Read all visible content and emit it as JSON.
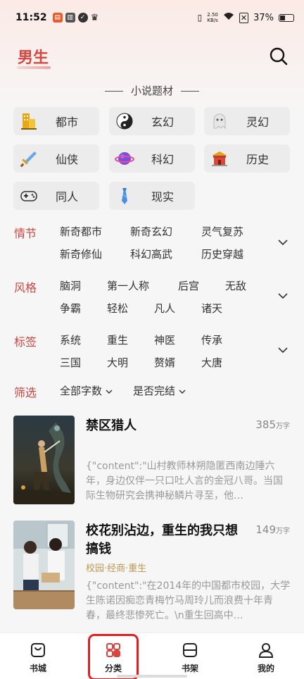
{
  "status_bar": {
    "time": "11:52",
    "net_speed_top": "2.50",
    "net_speed_bottom": "KB/s",
    "battery": "37%"
  },
  "header": {
    "title": "男生"
  },
  "section": {
    "label": "小说题材"
  },
  "genres": [
    {
      "label": "都市",
      "icon": "city-building-icon"
    },
    {
      "label": "玄幻",
      "icon": "yin-yang-icon"
    },
    {
      "label": "灵幻",
      "icon": "ghost-icon"
    },
    {
      "label": "仙侠",
      "icon": "sword-icon"
    },
    {
      "label": "科幻",
      "icon": "planet-icon"
    },
    {
      "label": "历史",
      "icon": "palace-icon"
    },
    {
      "label": "同人",
      "icon": "gamepad-icon"
    },
    {
      "label": "现实",
      "icon": "necktie-icon"
    }
  ],
  "filters": {
    "plot": {
      "label": "情节",
      "options": [
        "新奇都市",
        "新奇玄幻",
        "灵气复苏",
        "新奇修仙",
        "科幻高武",
        "历史穿越"
      ]
    },
    "style": {
      "label": "风格",
      "options": [
        "脑洞",
        "第一人称",
        "后宫",
        "无敌",
        "争霸",
        "轻松",
        "凡人",
        "诸天"
      ]
    },
    "tags": {
      "label": "标签",
      "options": [
        "系统",
        "重生",
        "神医",
        "传承",
        "三国",
        "大明",
        "赘婿",
        "大唐"
      ]
    },
    "screen": {
      "label": "筛选",
      "word_count": "全部字数",
      "completion": "是否完结"
    }
  },
  "books": [
    {
      "title": "禁区猎人",
      "words": "385",
      "unit": "万字",
      "tags": "",
      "desc": "{\"content\":\"山村教师林朔隐匿西南边陲六年，身边仅伴一只口吐人言的金冠八哥。当国际生物研究会携神秘鳞片寻至，他…"
    },
    {
      "title": "校花别沾边，重生的我只想搞钱",
      "words": "149",
      "unit": "万字",
      "tags": "校园·经商·重生",
      "desc": "{\"content\":\"在2014年的中国都市校园，大学生陈诺因痴恋青梅竹马周玲儿而浪费十年青春，最终悲惨死亡。\\n重生回高中…"
    }
  ],
  "nav": {
    "items": [
      {
        "label": "书城"
      },
      {
        "label": "分类"
      },
      {
        "label": "书架"
      },
      {
        "label": "我的"
      }
    ]
  },
  "colors": {
    "accent": "#d94640",
    "highlight": "#e02020",
    "tag": "#b89a52"
  }
}
